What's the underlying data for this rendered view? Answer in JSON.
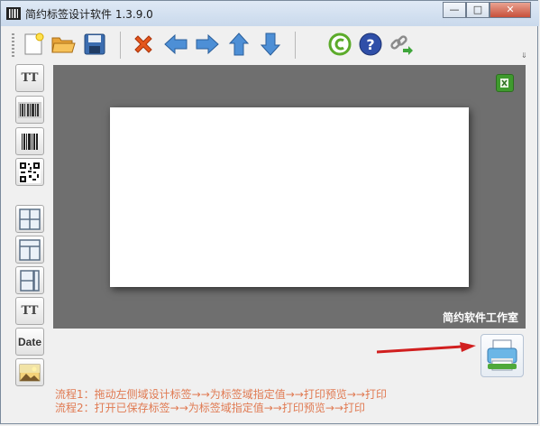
{
  "window": {
    "title": "简约标签设计软件  1.3.9.0",
    "controls": {
      "minimize": "—",
      "maximize": "□",
      "close": "✕"
    }
  },
  "toolbar": {
    "buttons": [
      {
        "name": "new-file-icon"
      },
      {
        "name": "open-folder-icon"
      },
      {
        "name": "save-icon"
      },
      {
        "name": "delete-icon"
      },
      {
        "name": "arrow-left-icon"
      },
      {
        "name": "arrow-right-icon"
      },
      {
        "name": "arrow-up-icon"
      },
      {
        "name": "arrow-down-icon"
      },
      {
        "name": "copyright-icon"
      },
      {
        "name": "help-icon"
      },
      {
        "name": "link-icon"
      }
    ]
  },
  "sidebar": {
    "text_tool": "TT",
    "text_tool2": "TT",
    "date_tool": "Date"
  },
  "canvas": {
    "watermark": "简约软件工作室",
    "background": "#6f6f6f"
  },
  "instructions": {
    "line1": "流程1：拖动左侧域设计标签→→为标签域指定值→→打印预览→→打印",
    "line2": "流程2：打开已保存标签→→为标签域指定值→→打印预览→→打印"
  },
  "colors": {
    "accent_text": "#e07a52",
    "arrow_red": "#d11f1f"
  }
}
